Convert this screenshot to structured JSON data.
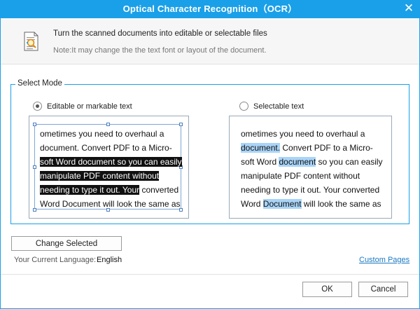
{
  "window": {
    "title": "Optical Character Recognition（OCR）",
    "close_glyph": "✕"
  },
  "header": {
    "main_text": "Turn the scanned documents into editable or selectable files",
    "note_text": "Note:It may change the the text font or layout of the document.",
    "icon": "document-search-icon"
  },
  "mode_group": {
    "legend": "Select Mode",
    "options": [
      {
        "label": "Editable or markable text",
        "selected": true
      },
      {
        "label": "Selectable text",
        "selected": false
      }
    ]
  },
  "preview_editable": {
    "lines": [
      [
        {
          "text": "ometimes you need to overhaul a",
          "hl": false
        }
      ],
      [
        {
          "text": "document. Convert PDF to a Micro-",
          "hl": false
        }
      ],
      [
        {
          "text": "soft Word document so you can easily",
          "hl": true
        }
      ],
      [
        {
          "text": "manipulate PDF content without",
          "hl": true
        }
      ],
      [
        {
          "text": "needing to type it out. Your",
          "hl": true
        },
        {
          "text": " converted",
          "hl": false
        }
      ],
      [
        {
          "text": "Word Document will look the same as",
          "hl": false
        }
      ]
    ]
  },
  "preview_selectable": {
    "lines": [
      [
        {
          "text": "ometimes you need to overhaul a",
          "hl": false
        }
      ],
      [
        {
          "text": "document.",
          "hl": true
        },
        {
          "text": " Convert PDF to a Micro-",
          "hl": false
        }
      ],
      [
        {
          "text": "soft Word ",
          "hl": false
        },
        {
          "text": "document",
          "hl": true
        },
        {
          "text": " so you can easily",
          "hl": false
        }
      ],
      [
        {
          "text": "manipulate PDF content without",
          "hl": false
        }
      ],
      [
        {
          "text": "needing to type it out. Your converted",
          "hl": false
        }
      ],
      [
        {
          "text": "Word ",
          "hl": false
        },
        {
          "text": "Document",
          "hl": true
        },
        {
          "text": " will look the same as",
          "hl": false
        }
      ]
    ]
  },
  "language": {
    "label": "Your Current Language:",
    "value": "English"
  },
  "buttons": {
    "change_selected": "Change Selected",
    "custom_pages": "Custom Pages",
    "ok": "OK",
    "cancel": "Cancel"
  },
  "colors": {
    "accent": "#1aa0e8",
    "link": "#1a79c2",
    "selection_blue": "#a9d4f7",
    "selection_dark": "#111111"
  }
}
